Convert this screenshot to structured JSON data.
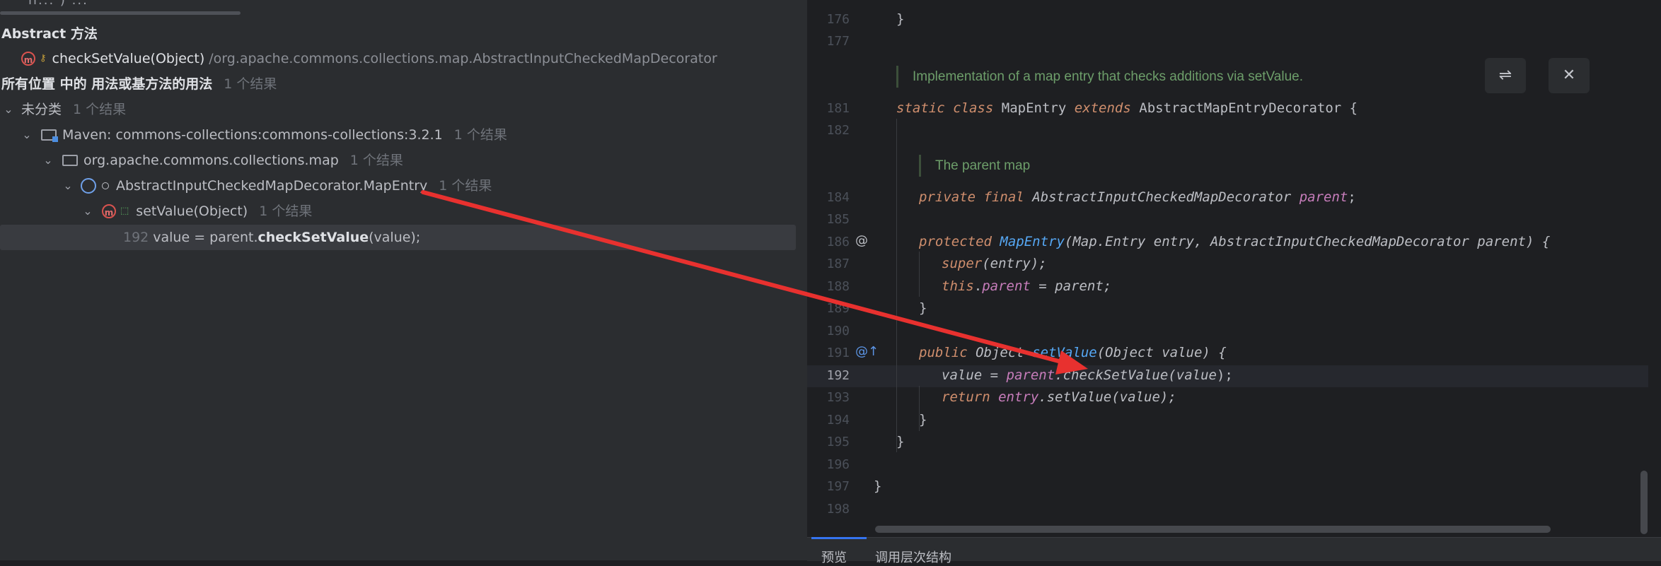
{
  "left_panel": {
    "top_fragment": "ll...   ) ...",
    "header_title": "Abstract 方法",
    "target_method": "checkSetValue(Object)",
    "target_path": "/org.apache.commons.collections.map.AbstractInputCheckedMapDecorator",
    "scope_label": "所有位置 中的 用法或基方法的用法",
    "scope_count": "1 个结果",
    "tree": [
      {
        "label": "未分类",
        "count": "1 个结果"
      },
      {
        "label": "Maven: commons-collections:commons-collections:3.2.1",
        "count": "1 个结果"
      },
      {
        "label": "org.apache.commons.collections.map",
        "count": "1 个结果"
      },
      {
        "label": "AbstractInputCheckedMapDecorator.MapEntry",
        "count": "1 个结果"
      },
      {
        "label": "setValue(Object)",
        "count": "1 个结果"
      }
    ],
    "usage": {
      "line": "192",
      "pre": "value = parent.",
      "method": "checkSetValue",
      "post": "(value);"
    }
  },
  "editor": {
    "line_numbers": [
      "176",
      "177",
      "181",
      "182",
      "184",
      "185",
      "186",
      "187",
      "188",
      "189",
      "190",
      "191",
      "192",
      "193",
      "194",
      "195",
      "196",
      "197",
      "198"
    ],
    "doc1": "Implementation of a map entry that checks additions via setValue.",
    "doc2": "The parent map",
    "code": {
      "l176": "}",
      "l181": {
        "kw1": "static",
        "kw2": "class",
        "name": "MapEntry",
        "kw3": "extends",
        "sup": "AbstractMapEntryDecorator",
        "rest": " {"
      },
      "l184": {
        "kw1": "private",
        "kw2": "final",
        "type": "AbstractInputCheckedMapDecorator",
        "fld": "parent",
        "rest": ";"
      },
      "l186": {
        "kw1": "protected",
        "fn": "MapEntry",
        "args": "(Map.Entry entry, AbstractInputCheckedMapDecorator parent) {"
      },
      "l187": {
        "kw": "super",
        "rest": "(entry);"
      },
      "l188": {
        "kw": "this",
        "dot": ".",
        "fld": "parent",
        "rest": " = parent;"
      },
      "l189": "}",
      "l191": {
        "kw": "public",
        "type": "Object",
        "fn": "setValue",
        "rest": "(Object value) {"
      },
      "l192": {
        "pre": "value = ",
        "fld": "parent",
        "mid": ".checkSetValue(",
        "arg": "value",
        "rest": ");"
      },
      "l193": {
        "kw": "return",
        "fld": "entry",
        "rest": ".setValue(value);"
      },
      "l194": "}",
      "l195": "}",
      "l197": "}"
    },
    "gutter_marks": {
      "l186": "@",
      "l191": "@↑"
    },
    "toolbar": {
      "wrap_icon": "⇌",
      "close_icon": "✕"
    },
    "bottom_tabs": [
      "预览",
      "调用层次结构"
    ]
  },
  "colors": {
    "arrow": "#e8312f",
    "keyword": "#cf8e6d",
    "field": "#c77dbb",
    "function": "#56a8f5",
    "doc": "#6d9e6a"
  }
}
